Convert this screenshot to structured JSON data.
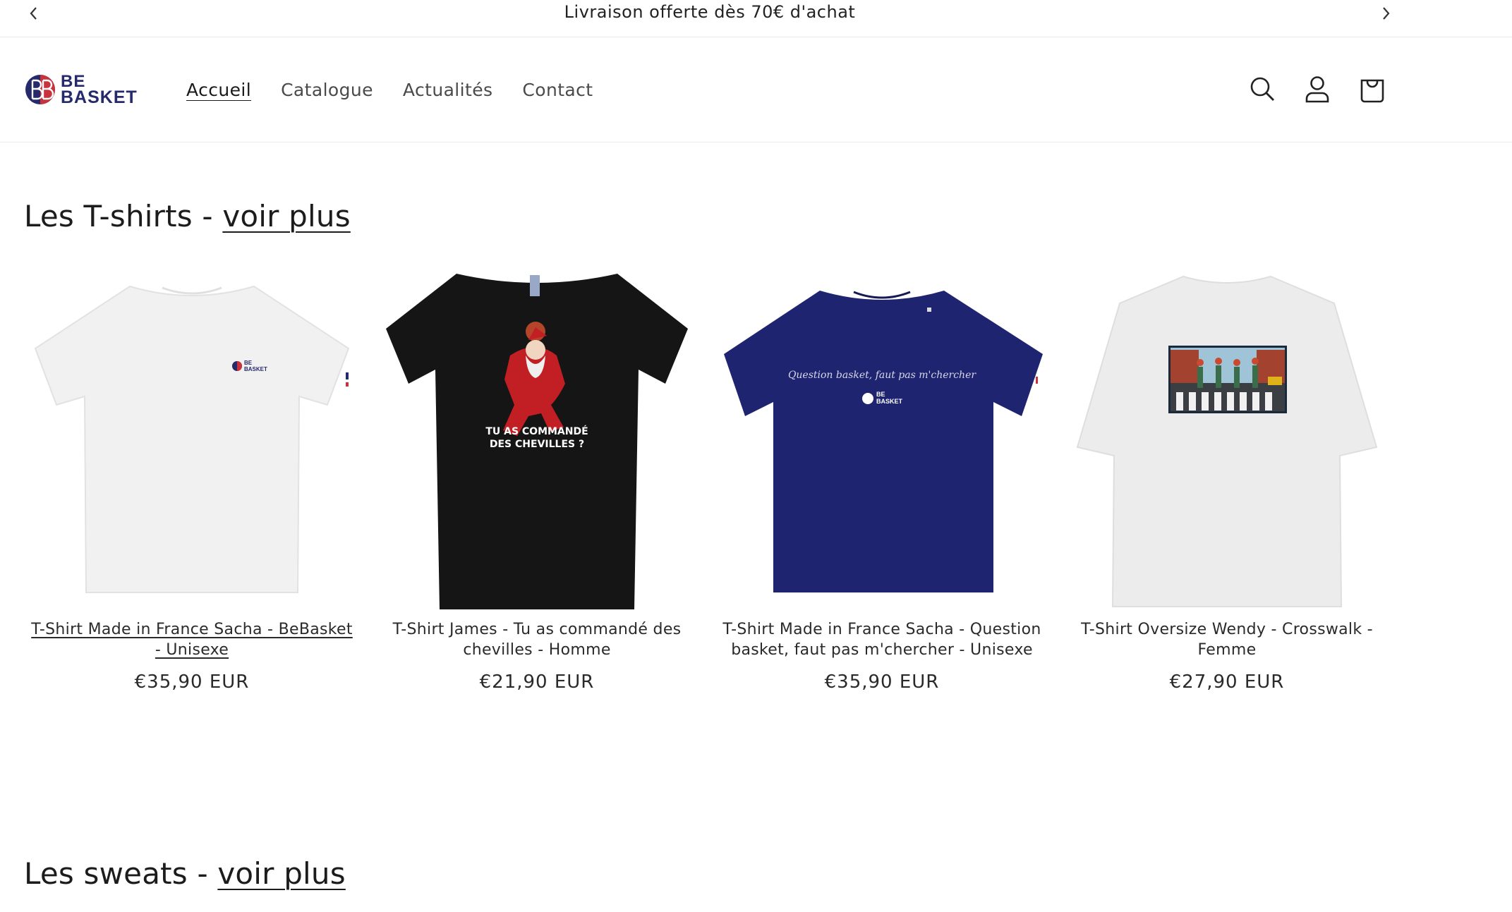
{
  "announcement": {
    "text": "Livraison offerte dès 70€ d'achat"
  },
  "brand": {
    "logo_line1": "BE",
    "logo_line2": "BASKET",
    "navy": "#262a6b",
    "red": "#c8323c"
  },
  "nav": {
    "items": [
      {
        "label": "Accueil"
      },
      {
        "label": "Catalogue"
      },
      {
        "label": "Actualités"
      },
      {
        "label": "Contact"
      }
    ]
  },
  "header_icons": [
    "search-icon",
    "account-icon",
    "cart-icon"
  ],
  "sections": [
    {
      "title_prefix": "Les T-shirts - ",
      "link": "voir plus"
    },
    {
      "title_prefix": "Les sweats - ",
      "link": "voir plus"
    }
  ],
  "products": [
    {
      "title": "T-Shirt Made in France Sacha - BeBasket - Unisexe",
      "price": "€35,90 EUR",
      "shirt_color": "#f1f1f1",
      "print_logo": "BE BASKET"
    },
    {
      "title": "T-Shirt James - Tu as commandé des chevilles - Homme",
      "price": "€21,90 EUR",
      "shirt_color": "#151515",
      "print_line1": "TU AS COMMANDÉ",
      "print_line2": "DES CHEVILLES ?"
    },
    {
      "title": "T-Shirt Made in France Sacha - Question basket, faut pas m'chercher - Unisexe",
      "price": "€35,90 EUR",
      "shirt_color": "#1e2470",
      "print_line1": "Question basket, faut pas m'chercher",
      "print_logo": "BE BASKET"
    },
    {
      "title": "T-Shirt Oversize Wendy - Crosswalk - Femme",
      "price": "€27,90 EUR",
      "shirt_color": "#ececec"
    }
  ]
}
